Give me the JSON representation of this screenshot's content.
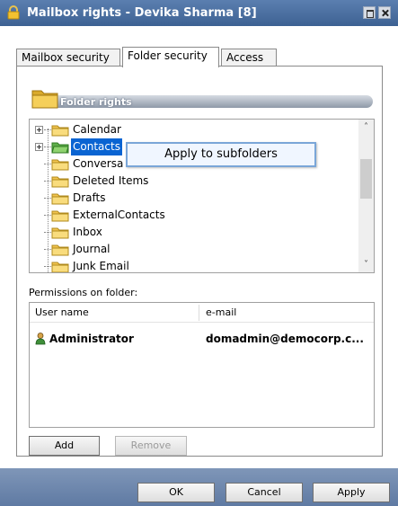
{
  "window": {
    "title": "Mailbox rights - Devika Sharma [8]"
  },
  "tabs": [
    {
      "label": "Mailbox security"
    },
    {
      "label": "Folder security"
    },
    {
      "label": "Access"
    }
  ],
  "folder_rights": {
    "title": "Folder rights",
    "folders": [
      {
        "name": "Calendar",
        "expandable": true
      },
      {
        "name": "Contacts",
        "expandable": true,
        "selected": true
      },
      {
        "name": "Conversa",
        "expandable": false
      },
      {
        "name": "Deleted Items",
        "expandable": false
      },
      {
        "name": "Drafts",
        "expandable": false
      },
      {
        "name": "ExternalContacts",
        "expandable": false
      },
      {
        "name": "Inbox",
        "expandable": false
      },
      {
        "name": "Journal",
        "expandable": false
      },
      {
        "name": "Junk Email",
        "expandable": false
      }
    ],
    "context_menu_item": "Apply to subfolders"
  },
  "permissions": {
    "label": "Permissions on folder:",
    "columns": [
      "User name",
      "e-mail"
    ],
    "rows": [
      {
        "user": "Administrator",
        "email": "domadmin@democorp.c..."
      }
    ],
    "add_label": "Add",
    "remove_label": "Remove"
  },
  "footer": {
    "ok_label": "OK",
    "cancel_label": "Cancel",
    "apply_label": "Apply"
  },
  "colors": {
    "title_bar": "#4a6fa5",
    "selection": "#0a64d2",
    "folder": "#f2c44f",
    "footer": "#6d87ad"
  }
}
